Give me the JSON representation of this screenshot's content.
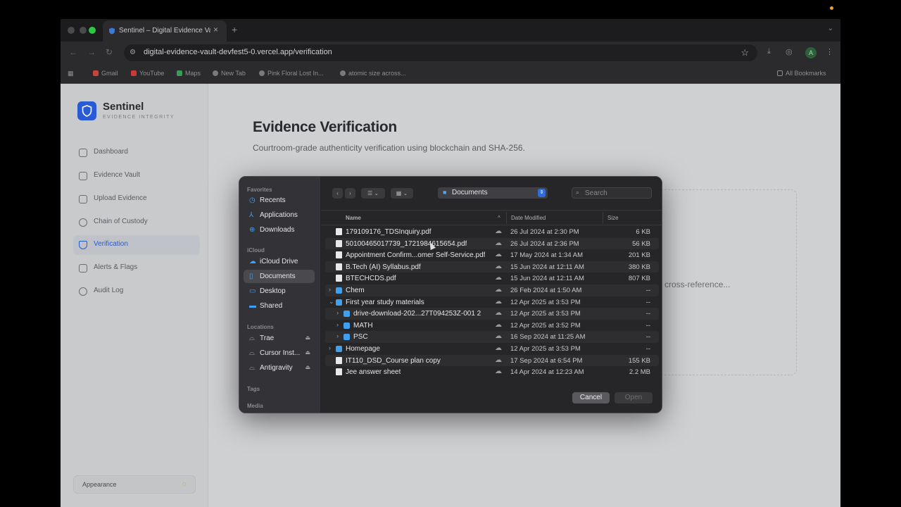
{
  "browser": {
    "tab_title": "Sentinel – Digital Evidence Vault",
    "tab_close": "×",
    "new_tab": "+",
    "url": "digital-evidence-vault-devfest5-0.vercel.app/verification",
    "profile_initial": "A",
    "bookmarks": [
      "Gmail",
      "YouTube",
      "Maps",
      "New Tab",
      "Pink Floral Lost In...",
      "atomic size across...",
      "All Bookmarks"
    ]
  },
  "sidebar": {
    "brand": "Sentinel",
    "brand_sub": "EVIDENCE INTEGRITY",
    "items": [
      {
        "label": "Dashboard",
        "icon": "grid-icon"
      },
      {
        "label": "Evidence Vault",
        "icon": "file-icon"
      },
      {
        "label": "Upload Evidence",
        "icon": "upload-icon"
      },
      {
        "label": "Chain of Custody",
        "icon": "chain-icon"
      },
      {
        "label": "Verification",
        "icon": "shield-icon"
      },
      {
        "label": "Alerts & Flags",
        "icon": "alert-icon"
      },
      {
        "label": "Audit Log",
        "icon": "history-icon"
      }
    ],
    "appearance": "Appearance"
  },
  "main": {
    "title": "Evidence Verification",
    "subtitle": "Courtroom-grade authenticity verification using blockchain and SHA-256.",
    "dropzone_text": "cross-reference..."
  },
  "dialog": {
    "favorites_hdr": "Favorites",
    "favorites": [
      "Recents",
      "Applications",
      "Downloads"
    ],
    "icloud_hdr": "iCloud",
    "icloud": [
      "iCloud Drive",
      "Documents",
      "Desktop",
      "Shared"
    ],
    "locations_hdr": "Locations",
    "locations": [
      "Trae",
      "Cursor Inst...",
      "Antigravity"
    ],
    "tags_hdr": "Tags",
    "media_hdr": "Media",
    "location": "Documents",
    "search_placeholder": "Search",
    "columns": {
      "name": "Name",
      "date": "Date Modified",
      "size": "Size"
    },
    "rows": [
      {
        "name": "179109176_TDSInquiry.pdf",
        "date": "26 Jul 2024 at 2:30 PM",
        "size": "6 KB",
        "kind": "file",
        "level": 0,
        "chev": ""
      },
      {
        "name": "50100465017739_1721984615654.pdf",
        "date": "26 Jul 2024 at 2:36 PM",
        "size": "56 KB",
        "kind": "file",
        "level": 0,
        "chev": ""
      },
      {
        "name": "Appointment Confirm...omer Self-Service.pdf",
        "date": "17 May 2024 at 1:34 AM",
        "size": "201 KB",
        "kind": "file",
        "level": 0,
        "chev": ""
      },
      {
        "name": "B.Tech (AI) Syllabus.pdf",
        "date": "15 Jun 2024 at 12:11 AM",
        "size": "380 KB",
        "kind": "file",
        "level": 0,
        "chev": ""
      },
      {
        "name": "BTECHCDS.pdf",
        "date": "15 Jun 2024 at 12:11 AM",
        "size": "807 KB",
        "kind": "file",
        "level": 0,
        "chev": ""
      },
      {
        "name": "Chem",
        "date": "26 Feb 2024 at 1:50 AM",
        "size": "--",
        "kind": "folder",
        "level": 0,
        "chev": "›"
      },
      {
        "name": "First year study materials",
        "date": "12 Apr 2025 at 3:53 PM",
        "size": "--",
        "kind": "folder",
        "level": 0,
        "chev": "⌄"
      },
      {
        "name": "drive-download-202...27T094253Z-001 2",
        "date": "12 Apr 2025 at 3:53 PM",
        "size": "--",
        "kind": "folder",
        "level": 1,
        "chev": "›"
      },
      {
        "name": "MATH",
        "date": "12 Apr 2025 at 3:52 PM",
        "size": "--",
        "kind": "folder",
        "level": 1,
        "chev": "›"
      },
      {
        "name": "PSC",
        "date": "16 Sep 2024 at 11:25 AM",
        "size": "--",
        "kind": "folder",
        "level": 1,
        "chev": "›"
      },
      {
        "name": "Homepage",
        "date": "12 Apr 2025 at 3:53 PM",
        "size": "--",
        "kind": "folder",
        "level": 0,
        "chev": "›"
      },
      {
        "name": "IT110_DSD_Course plan copy",
        "date": "17 Sep 2024 at 6:54 PM",
        "size": "155 KB",
        "kind": "file",
        "level": 0,
        "chev": ""
      },
      {
        "name": "Jee answer sheet",
        "date": "14 Apr 2024 at 12:23 AM",
        "size": "2.2 MB",
        "kind": "file",
        "level": 0,
        "chev": ""
      }
    ],
    "cancel": "Cancel",
    "open": "Open"
  }
}
